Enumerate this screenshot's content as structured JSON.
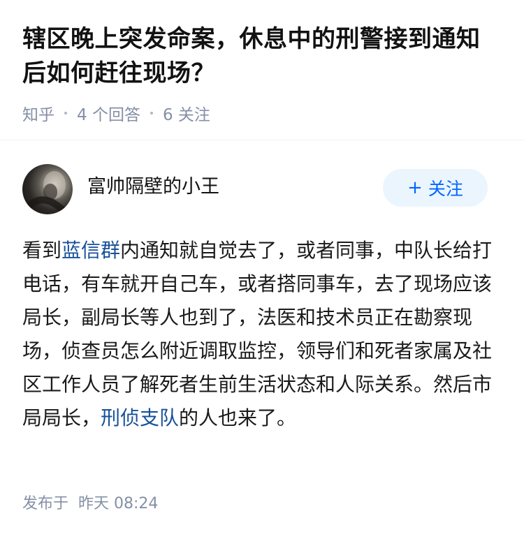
{
  "question": {
    "title": "辖区晚上突发命案，休息中的刑警接到通知后如何赶往现场？",
    "source": "知乎",
    "answer_count": "4 个回答",
    "follower_count": "6 关注"
  },
  "answer": {
    "author": {
      "name": "富帅隔壁的小王",
      "follow_label": "关注",
      "follow_icon": "plus-icon"
    },
    "content": {
      "part1": "看到",
      "link1": "蓝信群",
      "part2": "内通知就自觉去了，或者同事，中队长给打电话，有车就开自己车，或者搭同事车，去了现场应该局长，副局长等人也到了，法医和技术员正在勘察现场，侦查员怎么附近调取监控，领导们和死者家属及社区工作人员了解死者生前生活状态和人际关系。然后市局局长，",
      "link2": "刑侦支队",
      "part3": "的人也来了。"
    },
    "publish_label": "发布于",
    "publish_time": "昨天 08:24"
  },
  "colors": {
    "link": "#175199",
    "follow_text": "#0066ff",
    "follow_bg": "#ebf5fd",
    "meta": "#8590a6"
  }
}
